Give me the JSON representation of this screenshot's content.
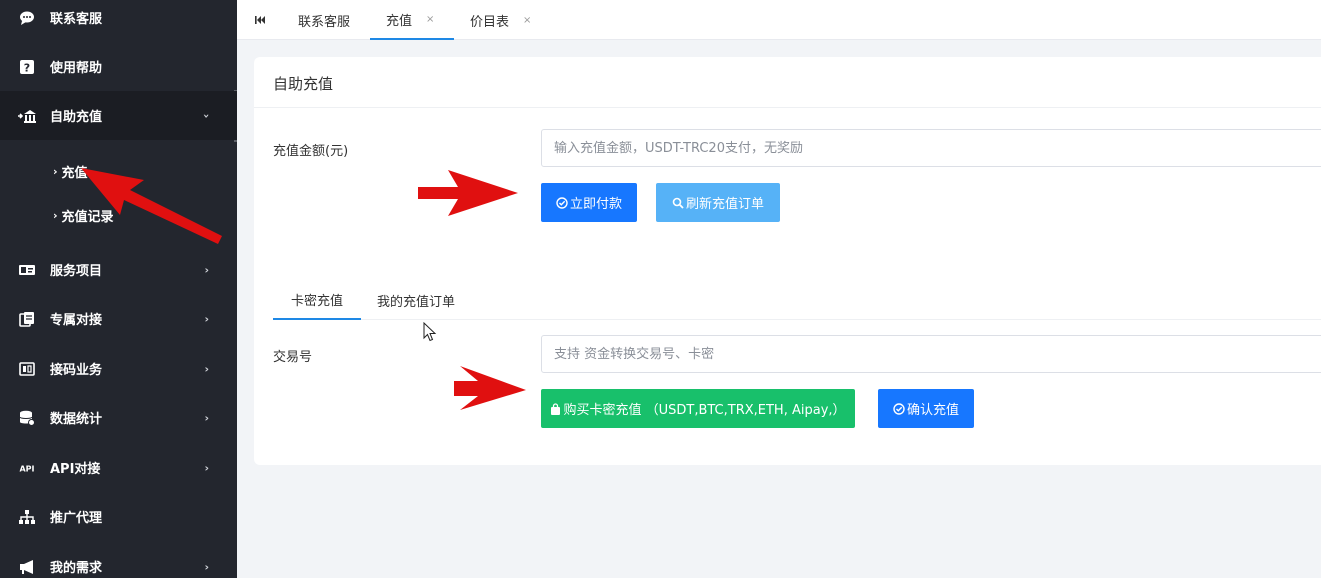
{
  "sidebar": {
    "items": [
      {
        "label": "联系客服",
        "icon": "chat-icon"
      },
      {
        "label": "使用帮助",
        "icon": "help-icon"
      },
      {
        "label": "自助充值",
        "icon": "bank-icon"
      },
      {
        "label": "服务项目",
        "icon": "card-icon"
      },
      {
        "label": "专属对接",
        "icon": "docs-icon"
      },
      {
        "label": "接码业务",
        "icon": "sim-icon"
      },
      {
        "label": "数据统计",
        "icon": "database-icon"
      },
      {
        "label": "API对接",
        "icon": "api-icon"
      },
      {
        "label": "推广代理",
        "icon": "sitemap-icon"
      },
      {
        "label": "我的需求",
        "icon": "megaphone-icon"
      }
    ],
    "sub_items": [
      {
        "label": "充值"
      },
      {
        "label": "充值记录"
      }
    ]
  },
  "tabs": [
    {
      "label": "联系客服"
    },
    {
      "label": "充值",
      "close": "×"
    },
    {
      "label": "价目表",
      "close": "×"
    }
  ],
  "card": {
    "title": "自助充值",
    "amount_label": "充值金额(元)",
    "amount_placeholder": "输入充值金额，USDT-TRC20支付，无奖励",
    "pay_button": "立即付款",
    "refresh_button": "刷新充值订单",
    "inner_tabs": [
      {
        "label": "卡密充值"
      },
      {
        "label": "我的充值订单"
      }
    ],
    "txn_label": "交易号",
    "txn_placeholder": "支持 资金转换交易号、卡密",
    "buy_button": "购买卡密充值 （USDT,BTC,TRX,ETH, Aipay,）",
    "confirm_button": "确认充值"
  },
  "colors": {
    "sidebar_bg": "#23262e",
    "primary": "#1777ff",
    "light_blue": "#56b2f7",
    "green": "#18c06b",
    "annotation_red": "#e01010"
  }
}
